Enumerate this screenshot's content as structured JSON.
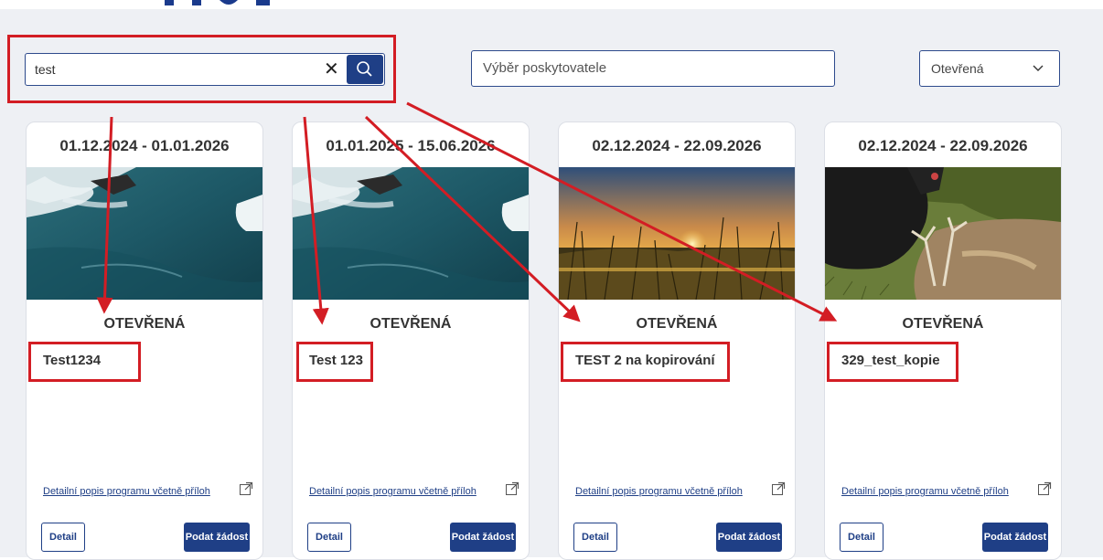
{
  "search": {
    "value": "test"
  },
  "provider": {
    "placeholder": "Výběr poskytovatele"
  },
  "status_filter": {
    "selected": "Otevřená"
  },
  "cards": [
    {
      "date": "01.12.2024 - 01.01.2026",
      "status": "OTEVŘENÁ",
      "name": "Test1234",
      "image": "ocean-waves-image",
      "link": "Detailní popis programu včetně příloh",
      "detail": "Detail",
      "apply": "Podat žádost"
    },
    {
      "date": "01.01.2025 - 15.06.2026",
      "status": "OTEVŘENÁ",
      "name": "Test 123",
      "image": "ocean-waves-image",
      "link": "Detailní popis programu včetně příloh",
      "detail": "Detail",
      "apply": "Podat žádost"
    },
    {
      "date": "02.12.2024 - 22.09.2026",
      "status": "OTEVŘENÁ",
      "name": "TEST 2 na kopirování",
      "image": "sunset-grass-image",
      "link": "Detailní popis programu včetně příloh",
      "detail": "Detail",
      "apply": "Podat žádost"
    },
    {
      "date": "02.12.2024 - 22.09.2026",
      "status": "OTEVŘENÁ",
      "name": "329_test_kopie",
      "image": "hunting-dog-deer-image",
      "link": "Detailní popis programu včetně příloh",
      "detail": "Detail",
      "apply": "Podat žádost"
    }
  ],
  "colors": {
    "primary": "#1f3f86",
    "annotation": "#d31d24",
    "background": "#eef0f4"
  }
}
